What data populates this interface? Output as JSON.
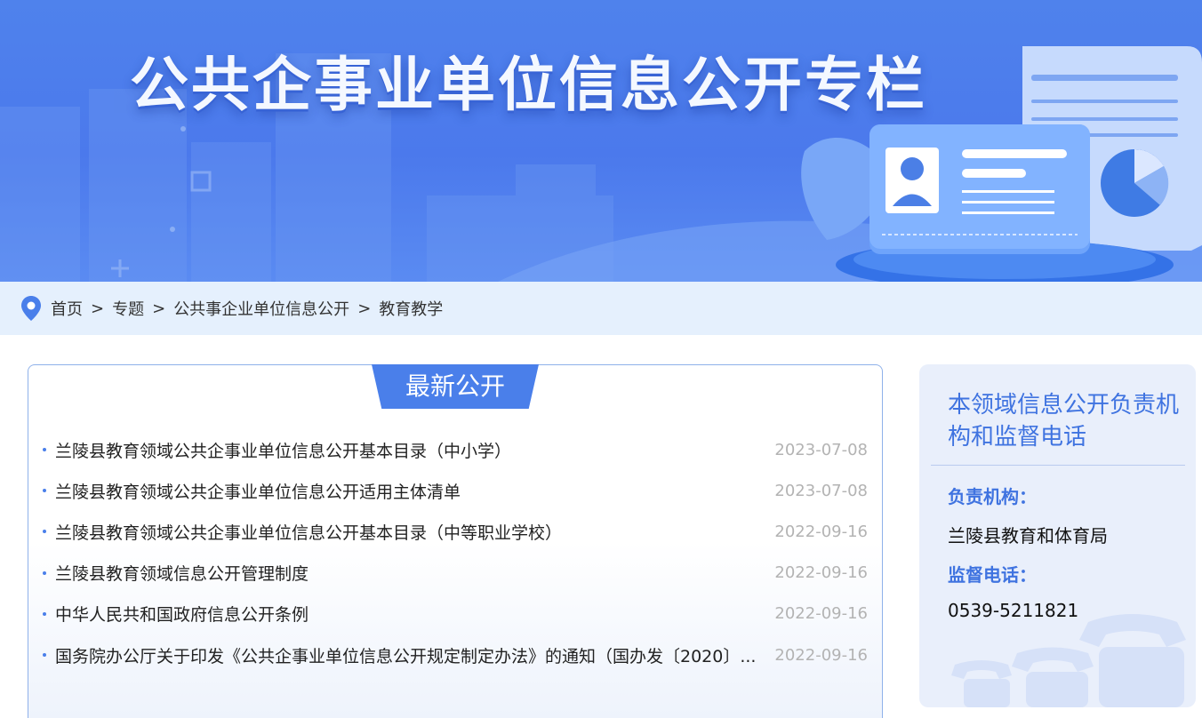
{
  "banner": {
    "title": "公共企事业单位信息公开专栏"
  },
  "breadcrumb": {
    "items": [
      "首页",
      "专题",
      "公共事企业单位信息公开",
      "教育教学"
    ],
    "separator": ">"
  },
  "latest": {
    "tab_label": "最新公开",
    "items": [
      {
        "title": "兰陵县教育领域公共企事业单位信息公开基本目录（中小学）",
        "date": "2023-07-08"
      },
      {
        "title": "兰陵县教育领域公共企事业单位信息公开适用主体清单",
        "date": "2023-07-08"
      },
      {
        "title": "兰陵县教育领域公共企事业单位信息公开基本目录（中等职业学校）",
        "date": "2022-09-16"
      },
      {
        "title": "兰陵县教育领域信息公开管理制度",
        "date": "2022-09-16"
      },
      {
        "title": "中华人民共和国政府信息公开条例",
        "date": "2022-09-16"
      },
      {
        "title": "国务院办公厅关于印发《公共企事业单位信息公开规定制定办法》的通知（国办发〔2020〕...",
        "date": "2022-09-16"
      }
    ]
  },
  "side": {
    "title": "本领域信息公开负责机构和监督电话",
    "org_label": "负责机构：",
    "org_value": "兰陵县教育和体育局",
    "phone_label": "监督电话：",
    "phone_value": "0539-5211821"
  },
  "colors": {
    "accent": "#4a7fea",
    "banner": "#4f82ec",
    "breadcrumb_bg": "#e5f0fd",
    "date": "#b3b3b3"
  },
  "icons": [
    "location-pin-icon",
    "id-card-icon",
    "document-icon",
    "pie-chart-icon",
    "telephone-icon"
  ]
}
